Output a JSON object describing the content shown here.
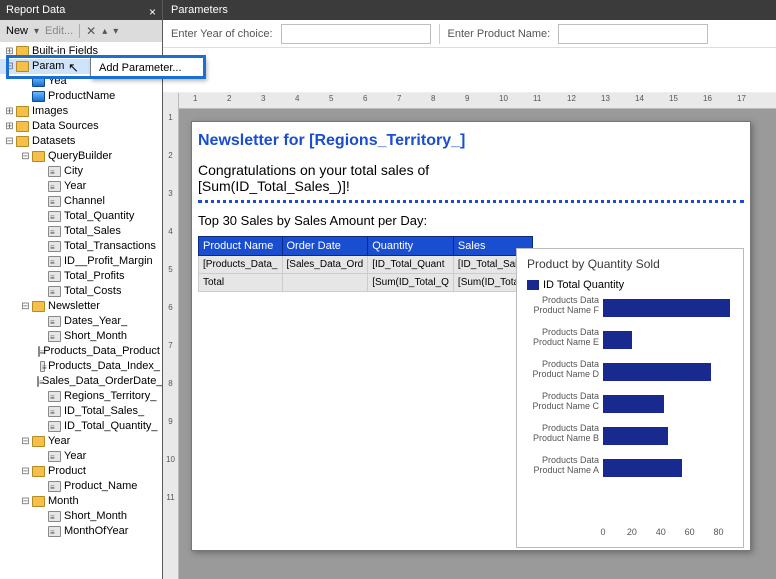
{
  "left_panel": {
    "title": "Report Data",
    "toolbar": {
      "new": "New",
      "edit": "Edit..."
    }
  },
  "tree": [
    {
      "d": 1,
      "t": "+",
      "i": "folder",
      "label": "Built-in Fields"
    },
    {
      "d": 1,
      "t": "-",
      "i": "folder",
      "label": "Param",
      "sel": true
    },
    {
      "d": 2,
      "t": " ",
      "i": "param",
      "label": "Yea"
    },
    {
      "d": 2,
      "t": " ",
      "i": "param",
      "label": "ProductName"
    },
    {
      "d": 1,
      "t": "+",
      "i": "folder",
      "label": "Images"
    },
    {
      "d": 1,
      "t": "+",
      "i": "folder",
      "label": "Data Sources"
    },
    {
      "d": 1,
      "t": "-",
      "i": "folder",
      "label": "Datasets"
    },
    {
      "d": 2,
      "t": "-",
      "i": "folder",
      "label": "QueryBuilder"
    },
    {
      "d": 3,
      "t": " ",
      "i": "fieldset",
      "label": "City"
    },
    {
      "d": 3,
      "t": " ",
      "i": "fieldset",
      "label": "Year"
    },
    {
      "d": 3,
      "t": " ",
      "i": "fieldset",
      "label": "Channel"
    },
    {
      "d": 3,
      "t": " ",
      "i": "fieldset",
      "label": "Total_Quantity"
    },
    {
      "d": 3,
      "t": " ",
      "i": "fieldset",
      "label": "Total_Sales"
    },
    {
      "d": 3,
      "t": " ",
      "i": "fieldset",
      "label": "Total_Transactions"
    },
    {
      "d": 3,
      "t": " ",
      "i": "fieldset",
      "label": "ID__Profit_Margin"
    },
    {
      "d": 3,
      "t": " ",
      "i": "fieldset",
      "label": "Total_Profits"
    },
    {
      "d": 3,
      "t": " ",
      "i": "fieldset",
      "label": "Total_Costs"
    },
    {
      "d": 2,
      "t": "-",
      "i": "folder",
      "label": "Newsletter"
    },
    {
      "d": 3,
      "t": " ",
      "i": "fieldset",
      "label": "Dates_Year_"
    },
    {
      "d": 3,
      "t": " ",
      "i": "fieldset",
      "label": "Short_Month"
    },
    {
      "d": 3,
      "t": " ",
      "i": "fieldset",
      "label": "Products_Data_Product"
    },
    {
      "d": 3,
      "t": " ",
      "i": "fieldset",
      "label": "Products_Data_Index_"
    },
    {
      "d": 3,
      "t": " ",
      "i": "fieldset",
      "label": "Sales_Data_OrderDate_"
    },
    {
      "d": 3,
      "t": " ",
      "i": "fieldset",
      "label": "Regions_Territory_"
    },
    {
      "d": 3,
      "t": " ",
      "i": "fieldset",
      "label": "ID_Total_Sales_"
    },
    {
      "d": 3,
      "t": " ",
      "i": "fieldset",
      "label": "ID_Total_Quantity_"
    },
    {
      "d": 2,
      "t": "-",
      "i": "folder",
      "label": "Year"
    },
    {
      "d": 3,
      "t": " ",
      "i": "fieldset",
      "label": "Year"
    },
    {
      "d": 2,
      "t": "-",
      "i": "folder",
      "label": "Product"
    },
    {
      "d": 3,
      "t": " ",
      "i": "fieldset",
      "label": "Product_Name"
    },
    {
      "d": 2,
      "t": "-",
      "i": "folder",
      "label": "Month"
    },
    {
      "d": 3,
      "t": " ",
      "i": "fieldset",
      "label": "Short_Month"
    },
    {
      "d": 3,
      "t": " ",
      "i": "fieldset",
      "label": "MonthOfYear"
    }
  ],
  "context_menu": {
    "add_parameter": "Add Parameter..."
  },
  "param_panel": {
    "title": "Parameters",
    "p1_label": "Enter Year of choice:",
    "p2_label": "Enter Product Name:"
  },
  "ruler_h": [
    "1",
    "2",
    "3",
    "4",
    "5",
    "6",
    "7",
    "8",
    "9",
    "10",
    "11",
    "12",
    "13",
    "14",
    "15",
    "16",
    "17"
  ],
  "ruler_v": [
    "1",
    "2",
    "3",
    "4",
    "5",
    "6",
    "7",
    "8",
    "9",
    "10",
    "11"
  ],
  "report": {
    "title": "Newsletter for [Regions_Territory_]",
    "line1": "Congratulations on your total sales of",
    "line2": "[Sum(ID_Total_Sales_)]!",
    "sub": "Top 30 Sales by Sales Amount per Day:",
    "headers": [
      "Product Name",
      "Order Date",
      "Quantity",
      "Sales"
    ],
    "row1": [
      "[Products_Data_",
      "[Sales_Data_Ord",
      "[ID_Total_Quant",
      "[ID_Total_Sales"
    ],
    "row2": [
      "Total",
      "",
      "[Sum(ID_Total_Q",
      "[Sum(ID_Total_"
    ]
  },
  "chart_data": {
    "type": "bar",
    "orientation": "horizontal",
    "title": "Product by Quantity Sold",
    "legend": "ID Total Quantity",
    "xlabel": "",
    "ylabel": "",
    "xlim": [
      0,
      90
    ],
    "ticks": [
      0,
      20,
      40,
      60,
      80
    ],
    "categories_line1": "Products Data",
    "series": [
      {
        "name": "Products Data Product Name  F",
        "value": 88
      },
      {
        "name": "Products Data Product Name  E",
        "value": 20
      },
      {
        "name": "Products Data Product Name  D",
        "value": 75
      },
      {
        "name": "Products Data Product Name  C",
        "value": 42
      },
      {
        "name": "Products Data Product Name  B",
        "value": 45
      },
      {
        "name": "Products Data Product Name  A",
        "value": 55
      }
    ]
  }
}
